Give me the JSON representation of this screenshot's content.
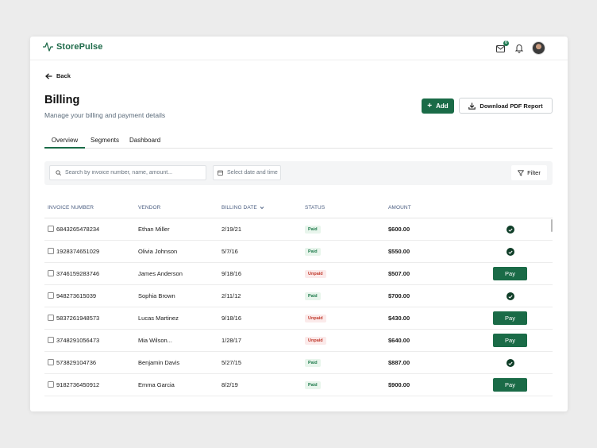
{
  "app": {
    "name": "StorePulse",
    "brand_color": "#1a6b47",
    "message_badge_count": "0"
  },
  "nav": {
    "back_label": "Back"
  },
  "header": {
    "title": "Billing",
    "subtitle": "Manage your billing and payment details",
    "add_label": "Add",
    "download_label": "Download PDF Report"
  },
  "tabs": [
    {
      "label": "Overview",
      "active": true
    },
    {
      "label": "Segments",
      "active": false
    },
    {
      "label": "Dashboard",
      "active": false
    }
  ],
  "filters": {
    "search_placeholder": "Search by invoice number, name, amount...",
    "date_placeholder": "Select date and time",
    "filter_label": "Filter"
  },
  "table": {
    "columns": [
      "INVOICE NUMBER",
      "VENDOR",
      "BILLING DATE",
      "STATUS",
      "AMOUNT"
    ],
    "pay_label": "Pay",
    "rows": [
      {
        "invoice": "6843265478234",
        "vendor": "Ethan Miller",
        "date": "2/19/21",
        "status": "Paid",
        "amount": "$600.00",
        "action": "check"
      },
      {
        "invoice": "1928374651029",
        "vendor": "Olivia Johnson",
        "date": "5/7/16",
        "status": "Paid",
        "amount": "$550.00",
        "action": "check"
      },
      {
        "invoice": "3746159283746",
        "vendor": "James Anderson",
        "date": "9/18/16",
        "status": "Unpaid",
        "amount": "$507.00",
        "action": "pay"
      },
      {
        "invoice": "948273615039",
        "vendor": "Sophia Brown",
        "date": "2/11/12",
        "status": "Paid",
        "amount": "$700.00",
        "action": "check"
      },
      {
        "invoice": "5837261948573",
        "vendor": "Lucas Martinez",
        "date": "9/18/16",
        "status": "Unpaid",
        "amount": "$430.00",
        "action": "pay"
      },
      {
        "invoice": "3748291056473",
        "vendor": "Mia Wilson...",
        "date": "1/28/17",
        "status": "Unpaid",
        "amount": "$640.00",
        "action": "pay"
      },
      {
        "invoice": "573829104736",
        "vendor": "Benjamin Davis",
        "date": "5/27/15",
        "status": "Paid",
        "amount": "$887.00",
        "action": "check"
      },
      {
        "invoice": "9182736450912",
        "vendor": "Emma Garcia",
        "date": "8/2/19",
        "status": "Paid",
        "amount": "$900.00",
        "action": "pay"
      }
    ]
  }
}
